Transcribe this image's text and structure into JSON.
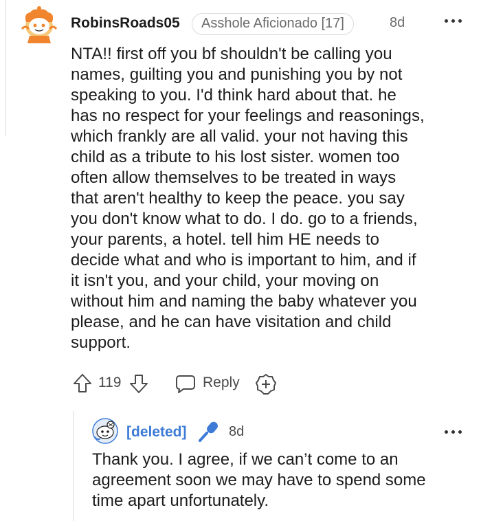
{
  "comment": {
    "username": "RobinsRoads05",
    "flair": "Asshole Aficionado [17]",
    "time": "8d",
    "body": "NTA!! first off you bf shouldn't be calling you\nnames, guilting you and punishing you by not\nspeaking to you. I'd think hard about that. he\nhas no respect for your feelings and reasonings,\nwhich frankly are all valid. your not having this\nchild as a tribute to his lost sister. women too\noften allow themselves to be treated in ways\nthat aren't healthy to keep the peace. you say\nyou don't know what to do. I do. go to a friends,\nyour parents, a hotel. tell him HE needs to\ndecide what and who is important to him, and if\nit isn't you, and your child, your moving on\nwithout him and naming the baby whatever you\nplease, and he can have visitation and child\nsupport.",
    "votes": "119",
    "reply_label": "Reply",
    "icons": {
      "avatar": "snoo-avatar-icon",
      "more": "more-options-icon",
      "upvote": "upvote-arrow-icon",
      "downvote": "downvote-arrow-icon",
      "reply": "reply-bubble-icon",
      "award": "award-plus-icon"
    }
  },
  "reply": {
    "username": "[deleted]",
    "time": "8d",
    "body": "Thank you. I agree, if we can’t come to an\nagreement soon we may have to spend some\ntime apart unfortunately.",
    "icons": {
      "avatar": "snoo-avatar-icon",
      "op": "microphone-icon",
      "more": "more-options-icon"
    }
  },
  "colors": {
    "text": "#1c1c1c",
    "meta": "#6b6b6b",
    "op_blue": "#3d7bd6",
    "avatar_orange": "#f0852d",
    "divider": "#d9d9d9"
  }
}
